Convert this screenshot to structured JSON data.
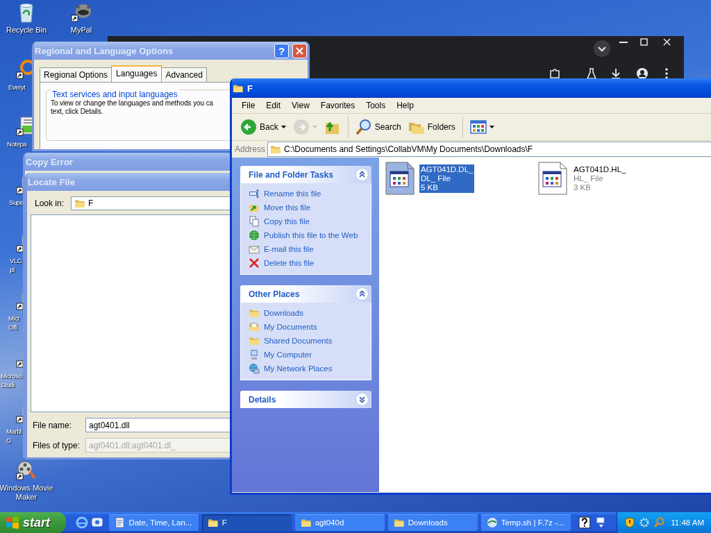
{
  "desktop_icons": [
    {
      "lines": [
        "Recycle Bin"
      ]
    },
    {
      "lines": [
        "MyPal"
      ]
    },
    {
      "lines": [
        "Everyt"
      ]
    },
    {
      "lines": [
        "Notepa"
      ]
    },
    {
      "lines": [
        "Supe"
      ]
    },
    {
      "lines": [
        "VLC",
        "pl"
      ]
    },
    {
      "lines": [
        "Micr",
        "Offi"
      ]
    },
    {
      "lines": [
        "Microso",
        "Studi"
      ]
    },
    {
      "lines": [
        "Marbl",
        "G"
      ]
    },
    {
      "lines": [
        "Windows Movie",
        "Maker"
      ]
    }
  ],
  "regional_dialog": {
    "title": "Regional and Language Options",
    "active": false,
    "help_button": "?",
    "tabs": [
      {
        "label": "Regional Options",
        "selected": false
      },
      {
        "label": "Languages",
        "selected": true
      },
      {
        "label": "Advanced",
        "selected": false
      }
    ],
    "group_title": "Text services and input languages",
    "text_lines": [
      "To view or change the languages and methods you ca",
      "text, click Details."
    ]
  },
  "copy_error": {
    "title": "Copy Error",
    "active": false
  },
  "locate_file": {
    "title": "Locate File",
    "active": false,
    "look_in_label": "Look in:",
    "look_in_value": "F",
    "file_name_label": "File name:",
    "file_name_value": "agt0401.dll",
    "file_type_label": "Files of type:",
    "file_type_value": "agt0401.dll;agt0401.dl_",
    "file_type_disabled": true
  },
  "explorer": {
    "title": "F",
    "active": true,
    "menu": [
      "File",
      "Edit",
      "View",
      "Favorites",
      "Tools",
      "Help"
    ],
    "toolbar": [
      {
        "kind": "back",
        "label": "Back",
        "disabled": false
      },
      {
        "kind": "forward",
        "disabled": true
      },
      {
        "kind": "up",
        "disabled": false
      },
      {
        "kind": "search",
        "label": "Search",
        "disabled": false
      },
      {
        "kind": "folders",
        "label": "Folders",
        "disabled": false
      },
      {
        "kind": "views",
        "disabled": false
      }
    ],
    "address_label": "Address",
    "address": "C:\\Documents and Settings\\CollabVM\\My Documents\\Downloads\\F",
    "panels": [
      {
        "title": "File and Folder Tasks",
        "expanded": true,
        "items": [
          {
            "kind": "rename",
            "label": "Rename this file"
          },
          {
            "kind": "move",
            "label": "Move this file"
          },
          {
            "kind": "copy",
            "label": "Copy this file"
          },
          {
            "kind": "publish",
            "label": "Publish this file to the Web"
          },
          {
            "kind": "email",
            "label": "E-mail this file"
          },
          {
            "kind": "delete",
            "label": "Delete this file"
          }
        ]
      },
      {
        "title": "Other Places",
        "expanded": true,
        "items": [
          {
            "kind": "folder",
            "label": "Downloads"
          },
          {
            "kind": "documents",
            "label": "My Documents"
          },
          {
            "kind": "folder",
            "label": "Shared Documents"
          },
          {
            "kind": "computer",
            "label": "My Computer"
          },
          {
            "kind": "network",
            "label": "My Network Places"
          }
        ]
      },
      {
        "title": "Details",
        "expanded": false
      }
    ],
    "files": [
      {
        "name": "AGT041D.DL_",
        "type": "DL_ File",
        "size": "5 KB",
        "selected": true
      },
      {
        "name": "AGT041D.HL_",
        "type": "HL_ File",
        "size": "3 KB",
        "selected": false
      }
    ]
  },
  "taskbar": {
    "start": "start",
    "tasks": [
      {
        "kind": "settings",
        "label": "Date, Time, Lan...",
        "selected": false
      },
      {
        "kind": "folder",
        "label": "F",
        "selected": true
      },
      {
        "kind": "folder",
        "label": "agt040d",
        "selected": false
      },
      {
        "kind": "folder",
        "label": "Downloads",
        "selected": false
      },
      {
        "kind": "browser",
        "label": "Temp.sh | F.7z -...",
        "selected": false
      }
    ],
    "clock": "11:48 AM"
  }
}
